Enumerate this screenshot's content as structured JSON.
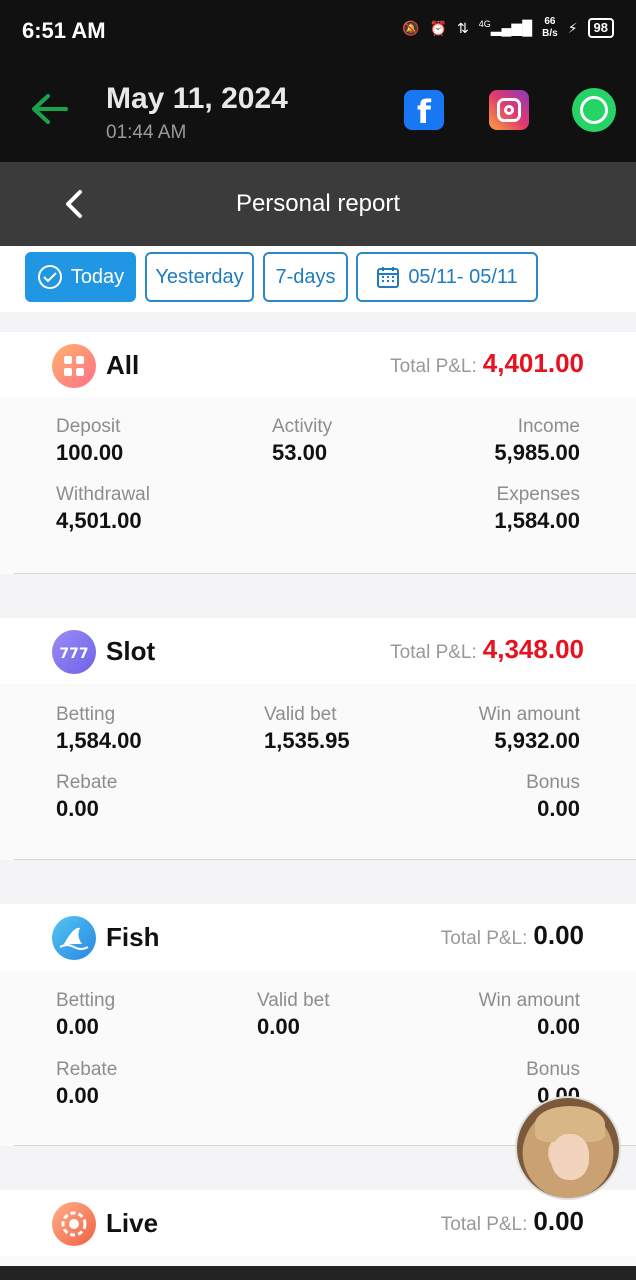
{
  "status_bar": {
    "time": "6:51 AM",
    "network": "4G",
    "speed_value": "66",
    "speed_unit": "B/s",
    "battery": "98"
  },
  "header": {
    "date": "May 11, 2024",
    "time": "01:44 AM"
  },
  "title_bar": {
    "title": "Personal report"
  },
  "filters": {
    "today": "Today",
    "yesterday": "Yesterday",
    "seven_days": "7-days",
    "range": "05/11- 05/11",
    "active": "today"
  },
  "colors": {
    "accent": "#2196e3",
    "loss_red": "#e5131f",
    "whatsapp": "#25d366",
    "facebook": "#1877f2"
  },
  "sections": {
    "all": {
      "name": "All",
      "pl_label": "Total P&L:",
      "pl_value": "4,401.00",
      "deposit_label": "Deposit",
      "deposit": "100.00",
      "activity_label": "Activity",
      "activity": "53.00",
      "income_label": "Income",
      "income": "5,985.00",
      "withdrawal_label": "Withdrawal",
      "withdrawal": "4,501.00",
      "expenses_label": "Expenses",
      "expenses": "1,584.00"
    },
    "slot": {
      "name": "Slot",
      "pl_label": "Total P&L:",
      "pl_value": "4,348.00",
      "betting_label": "Betting",
      "betting": "1,584.00",
      "valid_label": "Valid bet",
      "valid": "1,535.95",
      "win_label": "Win amount",
      "win": "5,932.00",
      "rebate_label": "Rebate",
      "rebate": "0.00",
      "bonus_label": "Bonus",
      "bonus": "0.00"
    },
    "fish": {
      "name": "Fish",
      "pl_label": "Total P&L:",
      "pl_value": "0.00",
      "betting_label": "Betting",
      "betting": "0.00",
      "valid_label": "Valid bet",
      "valid": "0.00",
      "win_label": "Win amount",
      "win": "0.00",
      "rebate_label": "Rebate",
      "rebate": "0.00",
      "bonus_label": "Bonus",
      "bonus": "0.00"
    },
    "live": {
      "name": "Live",
      "pl_label": "Total P&L:",
      "pl_value": "0.00"
    }
  }
}
